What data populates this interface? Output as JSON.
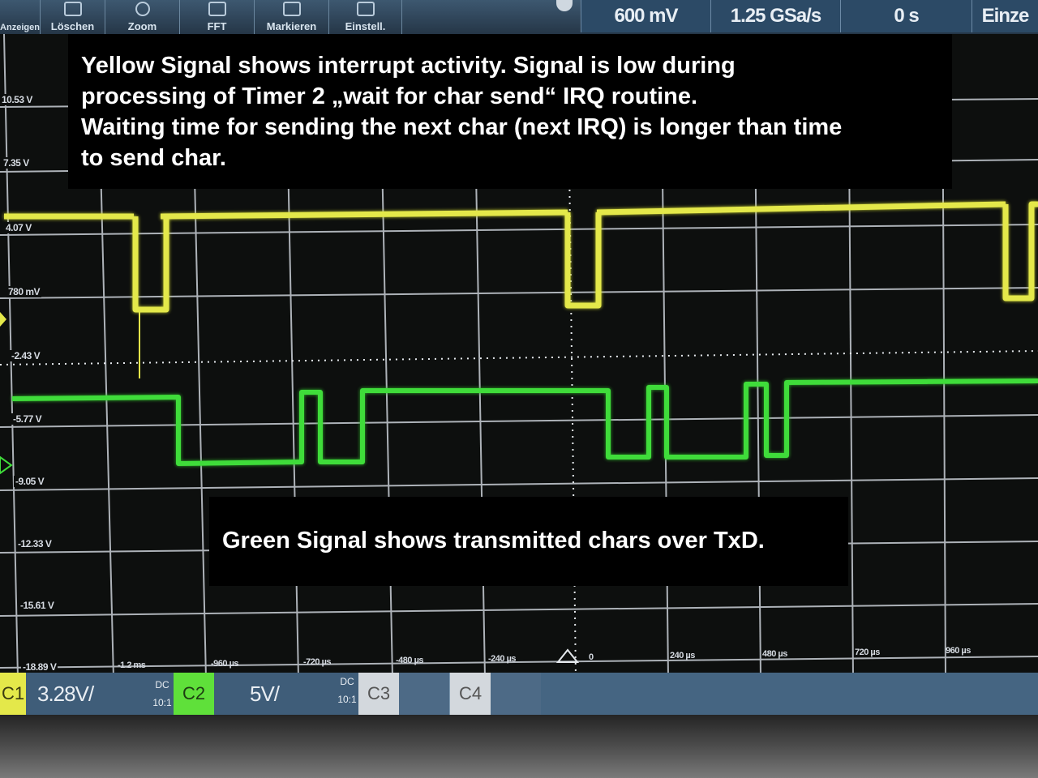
{
  "toolbar": {
    "items": [
      {
        "label": "Anzeigen"
      },
      {
        "label": "Löschen"
      },
      {
        "label": "Zoom"
      },
      {
        "label": "FFT"
      },
      {
        "label": "Markieren"
      },
      {
        "label": "Einstell."
      }
    ]
  },
  "status": {
    "vertical_scale": "600 mV",
    "sample_rate": "1.25 GSa/s",
    "time_offset": "0 s",
    "mode": "Einze"
  },
  "vertical_labels": [
    "10.53 V",
    "7.35 V",
    "4.07 V",
    "780 mV",
    "-2.43 V",
    "-5.77 V",
    "-9.05 V",
    "-12.33 V",
    "-15.61 V",
    "-18.89 V"
  ],
  "time_labels": [
    "-1.2 ms",
    "-960 µs",
    "-720 µs",
    "-480 µs",
    "-240 µs",
    "0",
    "240 µs",
    "480 µs",
    "720 µs",
    "960 µs"
  ],
  "annotations": {
    "yellow": {
      "line1": "Yellow Signal shows interrupt activity. Signal is low during",
      "line2": "processing of Timer 2 „wait for char send“ IRQ routine.",
      "line3": "Waiting time for sending the next char (next IRQ) is longer than time",
      "line4": "to send char."
    },
    "green": "Green Signal shows transmitted chars over TxD."
  },
  "channels": {
    "c1": {
      "tag": "C1",
      "scale": "3.28V/",
      "coupling": "DC",
      "probe": "10:1",
      "color": "#e4e84a"
    },
    "c2": {
      "tag": "C2",
      "scale": "5V/",
      "coupling": "DC",
      "probe": "10:1",
      "color": "#3fdc3a"
    },
    "c3": {
      "tag": "C3"
    },
    "c4": {
      "tag": "C4"
    }
  }
}
